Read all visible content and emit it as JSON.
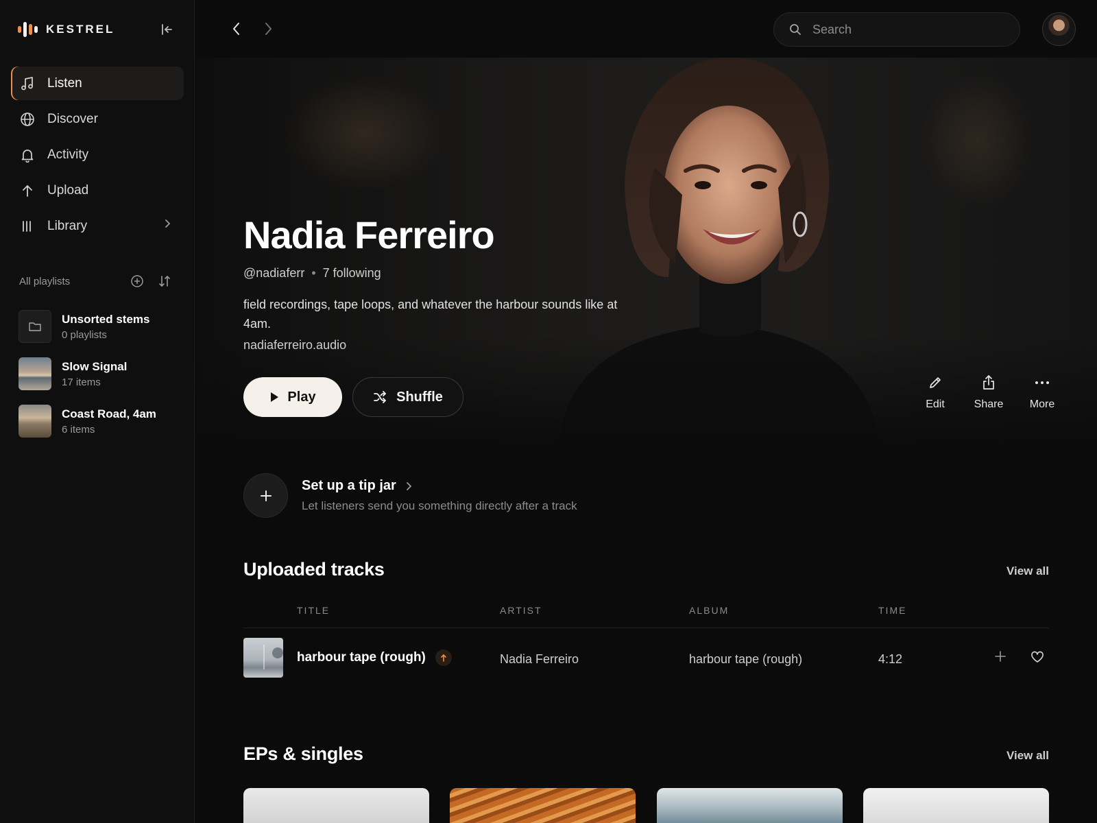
{
  "brand": {
    "name": "KESTREL",
    "accent": "#e9904d"
  },
  "sidebar": {
    "nav": [
      {
        "label": "Listen",
        "icon": "music-note-icon",
        "active": true
      },
      {
        "label": "Discover",
        "icon": "globe-icon"
      },
      {
        "label": "Activity",
        "icon": "bell-icon"
      },
      {
        "label": "Upload",
        "icon": "arrow-up-icon"
      },
      {
        "label": "Library",
        "icon": "library-icon"
      }
    ],
    "playlists_title": "All playlists",
    "playlists": [
      {
        "name": "Unsorted stems",
        "sub": "0 playlists"
      },
      {
        "name": "Slow Signal",
        "sub": "17 items"
      },
      {
        "name": "Coast Road, 4am",
        "sub": "6 items"
      }
    ]
  },
  "search": {
    "placeholder": "Search"
  },
  "profile": {
    "name": "Nadia Ferreiro",
    "handle": "@nadiaferr",
    "following": "7 following",
    "bio": "field recordings, tape loops, and whatever the harbour sounds like at 4am.",
    "website": "nadiaferreiro.audio",
    "play_label": "Play",
    "shuffle_label": "Shuffle",
    "actions": {
      "edit": "Edit",
      "share": "Share",
      "more": "More"
    }
  },
  "tip_jar": {
    "title": "Set up a tip jar",
    "subtitle": "Let listeners send you something directly after a track"
  },
  "tracks": {
    "title": "Uploaded tracks",
    "view_all": "View all",
    "columns": {
      "title": "TITLE",
      "artist": "ARTIST",
      "album": "ALBUM",
      "time": "TIME"
    },
    "rows": [
      {
        "title": "harbour tape (rough)",
        "artist": "Nadia Ferreiro",
        "album": "harbour tape (rough)",
        "time": "4:12"
      }
    ]
  },
  "eps": {
    "title": "EPs & singles",
    "view_all": "View all"
  }
}
